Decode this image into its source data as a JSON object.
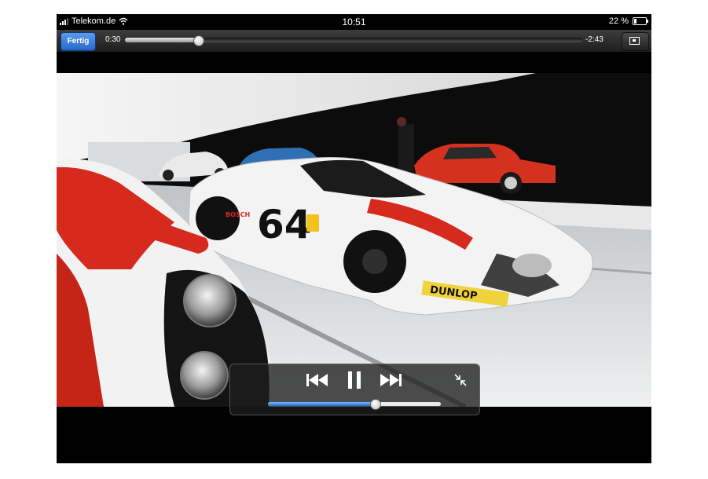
{
  "status_bar": {
    "carrier": "Telekom.de",
    "time": "10:51",
    "battery_label": "22 %",
    "battery_level": 0.22,
    "signal_bars": 3
  },
  "controls": {
    "done_label": "Fertig",
    "elapsed": "0:30",
    "remaining": "-2:43",
    "playback_progress": 0.16,
    "volume_level": 0.62
  },
  "video": {
    "car_number": "64",
    "sponsor": "DUNLOP",
    "side_sponsor": "BOSCH",
    "colors": {
      "car_white": "#f2f2f2",
      "stripe_red": "#d62a1e",
      "floor": "#dcdcdc"
    }
  },
  "icons": {
    "previous": "skip-back-icon",
    "play_pause": "pause-icon",
    "next": "skip-forward-icon",
    "exit_fullscreen": "shrink-icon",
    "fit": "fit-screen-icon",
    "wifi": "wifi-icon",
    "battery": "battery-icon"
  },
  "colors": {
    "accent_blue": "#2768c8",
    "bar_dark": "#1e1e1e"
  }
}
